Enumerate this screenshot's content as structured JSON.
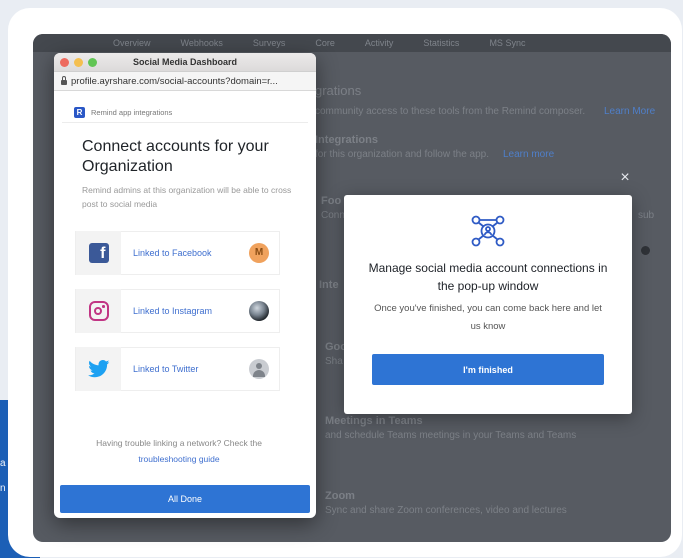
{
  "left_edge": {
    "lines": [
      "a",
      "n"
    ]
  },
  "app_background": {
    "nav": [
      "Overview",
      "Webhooks",
      "Surveys",
      "Core",
      "Activity",
      "Statistics",
      "MS Sync"
    ],
    "section_title": "grations",
    "section_desc": "community access to these tools from the Remind composer.",
    "learn_more": "Learn More",
    "item1_title": "Integrations",
    "item1_desc": "for this organization and follow the app.",
    "item1_link": "Learn more",
    "item2_title": "Foo",
    "item2_desc": "Conn",
    "item2_right": "sub",
    "item3_title": "Inte",
    "item4_title": "Goo",
    "item4_desc": "Sha",
    "item5_title": "Meetings in Teams",
    "item5_desc": "and schedule Teams meetings in your Teams and Teams",
    "item6_title": "Zoom",
    "item6_desc": "Sync and share Zoom conferences, video and lectures"
  },
  "popup": {
    "window_title": "Social Media Dashboard",
    "url": "profile.ayrshare.com/social-accounts?domain=r...",
    "remind_label": "Remind app integrations",
    "heading": "Connect accounts for your Organization",
    "subtext": "Remind admins at this organization will be able to cross post to social media",
    "networks": [
      {
        "label": "Linked to Facebook",
        "avatar_initial": "M"
      },
      {
        "label": "Linked to Instagram"
      },
      {
        "label": "Linked to Twitter"
      }
    ],
    "trouble_text": "Having trouble linking a network? Check the",
    "trouble_link": "troubleshooting guide",
    "all_done": "All Done"
  },
  "modal": {
    "close": "×",
    "title": "Manage social media account connections in the pop-up window",
    "subtitle": "Once you've finished, you can come back here and let us know",
    "button": "I'm finished"
  },
  "colors": {
    "primary": "#2e74d4",
    "facebook": "#3b5998",
    "instagram": "#c13584",
    "twitter": "#1da1f2",
    "link": "#3f6fcf"
  },
  "icons": [
    "lock-icon",
    "facebook-icon",
    "instagram-icon",
    "twitter-icon",
    "network-nodes-icon",
    "close-icon"
  ]
}
